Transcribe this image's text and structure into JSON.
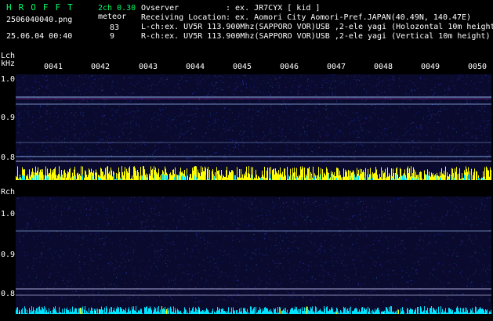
{
  "header": {
    "brand": "HROFFT",
    "version": "2ch 0.30",
    "filename": "2506040040.png",
    "mode": "meteor",
    "datetime": "25.06.04 00:40",
    "l_count": "83",
    "r_count": "9",
    "observer_label": "Ovserver",
    "observer_value": ": ex. JR7CYX [ kid ]",
    "location_label": "Receiving Location",
    "location_value": ": ex. Aomori City Aomori-Pref.JAPAN(40.49N, 140.47E)",
    "lch_info": "L-ch:ex. UV5R 113.900Mhz(SAPPORO VOR)USB ,2-ele yagi (Holozontal 10m height",
    "rch_info": "R-ch:ex. UV5R 113.900Mhz(SAPPORO VOR)USB ,2-ele yagi (Vertical 10m height)"
  },
  "lch": {
    "label": "Lch",
    "unit": "kHz",
    "ticks": [
      "1.0",
      "0.9",
      "0.8"
    ]
  },
  "rch": {
    "label": "Rch",
    "ticks": [
      "1.0",
      "0.9",
      "0.8"
    ]
  },
  "time_ticks": [
    "0041",
    "0042",
    "0043",
    "0044",
    "0045",
    "0046",
    "0047",
    "0048",
    "0049",
    "0050"
  ],
  "colors": {
    "background": "#000000",
    "text_green": "#00ff66",
    "text_white": "#ffffff",
    "noise_yellow": "#ffff00",
    "noise_cyan": "#00e5ff",
    "trace": "#a0c8ff"
  }
}
